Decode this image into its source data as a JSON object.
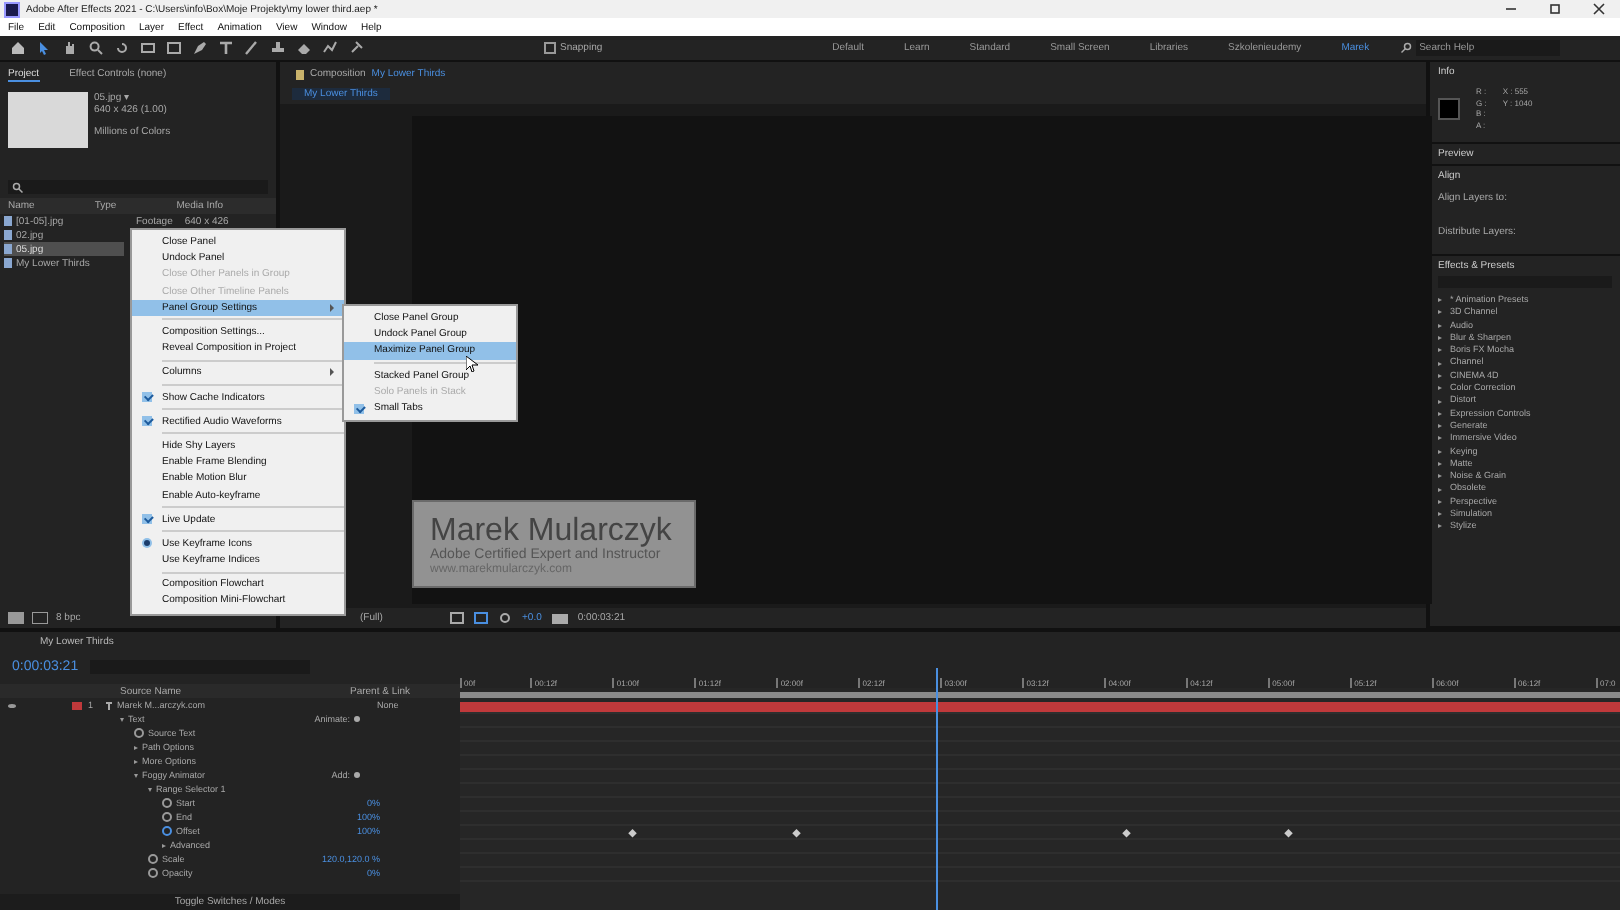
{
  "window": {
    "title": "Adobe After Effects 2021 - C:\\Users\\info\\Box\\Moje Projekty\\my lower third.aep *"
  },
  "menu_bar": [
    "File",
    "Edit",
    "Composition",
    "Layer",
    "Effect",
    "Animation",
    "View",
    "Window",
    "Help"
  ],
  "toolbar": {
    "snapping": "Snapping",
    "snapping_checked": false,
    "workspaces": [
      {
        "label": "Default",
        "selected": false
      },
      {
        "label": "Learn",
        "selected": false
      },
      {
        "label": "Standard",
        "selected": false
      },
      {
        "label": "Small Screen",
        "selected": false
      },
      {
        "label": "Libraries",
        "selected": false
      },
      {
        "label": "Szkolenieudemy",
        "selected": false
      },
      {
        "label": "Marek",
        "selected": true
      }
    ],
    "search_placeholder": "Search Help"
  },
  "project_panel": {
    "tabs": [
      {
        "label": "Project",
        "selected": true
      },
      {
        "label": "Effect Controls (none)",
        "selected": false
      }
    ],
    "preview_name": "05.jpg ▾",
    "preview_size": "640 x 426 (1.00)",
    "preview_colors": "Millions of Colors",
    "columns": [
      "Name",
      "Type",
      "Media Info"
    ],
    "items": [
      {
        "name": "[01-05].jpg",
        "type": "Footage",
        "info": "640 x 426",
        "selected": false
      },
      {
        "name": "02.jpg",
        "selected": false
      },
      {
        "name": "05.jpg",
        "selected": true
      },
      {
        "name": "My Lower Thirds",
        "selected": false
      }
    ],
    "bit_depth": "8 bpc"
  },
  "composition_panel": {
    "label": "Composition",
    "name": "My Lower Thirds",
    "tab": "My Lower Thirds",
    "lower_third": {
      "title": "Marek Mularczyk",
      "subtitle": "Adobe Certified Expert and Instructor",
      "url": "www.marekmularczyk.com"
    },
    "zoom": "(Full)",
    "exposure": "+0.0",
    "time": "0:00:03:21"
  },
  "right_panel": {
    "info": {
      "title": "Info",
      "channels": [
        "R :",
        "G :",
        "B :",
        "A :"
      ],
      "x": "X : 555",
      "y": "Y : 1040"
    },
    "preview": "Preview",
    "align": {
      "title": "Align",
      "align_to": "Align Layers to:",
      "distribute": "Distribute Layers:"
    },
    "effects": {
      "title": "Effects & Presets",
      "items": [
        "* Animation Presets",
        "3D Channel",
        "Audio",
        "Blur & Sharpen",
        "Boris FX Mocha",
        "Channel",
        "CINEMA 4D",
        "Color Correction",
        "Distort",
        "Expression Controls",
        "Generate",
        "Immersive Video",
        "Keying",
        "Matte",
        "Noise & Grain",
        "Obsolete",
        "Perspective",
        "Simulation",
        "Stylize"
      ]
    }
  },
  "context_menu": {
    "groups": [
      [
        {
          "label": "Close Panel",
          "kind": "command",
          "disabled": false,
          "selected": false
        },
        {
          "label": "Undock Panel",
          "kind": "command",
          "disabled": false,
          "selected": false
        },
        {
          "label": "Close Other Panels in Group",
          "kind": "command",
          "disabled": true,
          "selected": false
        },
        {
          "label": "Close Other Timeline Panels",
          "kind": "command",
          "disabled": true,
          "selected": false
        },
        {
          "label": "Panel Group Settings",
          "kind": "submenu",
          "disabled": false,
          "selected": true
        }
      ],
      [
        {
          "label": "Composition Settings...",
          "kind": "command",
          "disabled": false,
          "selected": false
        },
        {
          "label": "Reveal Composition in Project",
          "kind": "command",
          "disabled": false,
          "selected": false
        }
      ],
      [
        {
          "label": "Columns",
          "kind": "submenu",
          "disabled": false,
          "selected": false
        }
      ],
      [
        {
          "label": "Show Cache Indicators",
          "kind": "check",
          "checked": true,
          "selected": false
        }
      ],
      [
        {
          "label": "Rectified Audio Waveforms",
          "kind": "check",
          "checked": true,
          "selected": false
        }
      ],
      [
        {
          "label": "Hide Shy Layers",
          "kind": "command",
          "disabled": false,
          "selected": false
        },
        {
          "label": "Enable Frame Blending",
          "kind": "command",
          "disabled": false,
          "selected": false
        },
        {
          "label": "Enable Motion Blur",
          "kind": "command",
          "disabled": false,
          "selected": false
        },
        {
          "label": "Enable Auto-keyframe",
          "kind": "command",
          "disabled": false,
          "selected": false
        }
      ],
      [
        {
          "label": "Live Update",
          "kind": "check",
          "checked": true,
          "selected": false
        }
      ],
      [
        {
          "label": "Use Keyframe Icons",
          "kind": "radio",
          "checked": true,
          "selected": false
        },
        {
          "label": "Use Keyframe Indices",
          "kind": "radio",
          "checked": false,
          "selected": false
        }
      ],
      [
        {
          "label": "Composition Flowchart",
          "kind": "command",
          "disabled": false,
          "selected": false
        },
        {
          "label": "Composition Mini-Flowchart",
          "kind": "command",
          "disabled": false,
          "selected": false
        }
      ]
    ]
  },
  "submenu": {
    "groups": [
      [
        {
          "label": "Close Panel Group",
          "kind": "command",
          "disabled": false,
          "selected": false
        },
        {
          "label": "Undock Panel Group",
          "kind": "command",
          "disabled": false,
          "selected": false
        },
        {
          "label": "Maximize Panel Group",
          "kind": "command",
          "disabled": false,
          "selected": true
        }
      ],
      [
        {
          "label": "Stacked Panel Group",
          "kind": "command",
          "disabled": false,
          "selected": false
        },
        {
          "label": "Solo Panels in Stack",
          "kind": "command",
          "disabled": true,
          "selected": false
        },
        {
          "label": "Small Tabs",
          "kind": "check",
          "checked": true,
          "selected": false
        }
      ]
    ]
  },
  "timeline": {
    "tab": "My Lower Thirds",
    "time": "0:00:03:21",
    "columns": [
      "Source Name",
      "Parent & Link"
    ],
    "ruler": [
      "00f",
      "00:12f",
      "01:00f",
      "01:12f",
      "02:00f",
      "02:12f",
      "03:00f",
      "03:12f",
      "04:00f",
      "04:12f",
      "05:00f",
      "05:12f",
      "06:00f",
      "06:12f",
      "07:0"
    ],
    "rows": [
      {
        "kind": "layer",
        "number": "1",
        "name": "Marek M...arczyk.com",
        "parent": "None",
        "color": "#c0393b"
      },
      {
        "kind": "group",
        "name": "Text",
        "action": "Animate:",
        "children": [
          {
            "kind": "property",
            "name": "Source Text"
          },
          {
            "kind": "group",
            "name": "Path Options",
            "expanded": false
          },
          {
            "kind": "group",
            "name": "More Options",
            "expanded": false
          },
          {
            "kind": "group",
            "name": "Foggy Animator",
            "action": "Add:",
            "expanded": true,
            "children": [
              {
                "kind": "group",
                "name": "Range Selector 1",
                "expanded": true,
                "children": [
                  {
                    "kind": "property",
                    "name": "Start",
                    "value": "0%"
                  },
                  {
                    "kind": "property",
                    "name": "End",
                    "value": "100%"
                  },
                  {
                    "kind": "property",
                    "name": "Offset",
                    "value": "100%",
                    "keyframes": true
                  },
                  {
                    "kind": "group",
                    "name": "Advanced",
                    "expanded": false
                  }
                ]
              },
              {
                "kind": "property",
                "name": "Scale",
                "value": "120.0,120.0 %"
              },
              {
                "kind": "property",
                "name": "Opacity",
                "value": "0%"
              }
            ]
          }
        ],
        "expanded": true
      }
    ],
    "footer": "Toggle Switches / Modes"
  }
}
